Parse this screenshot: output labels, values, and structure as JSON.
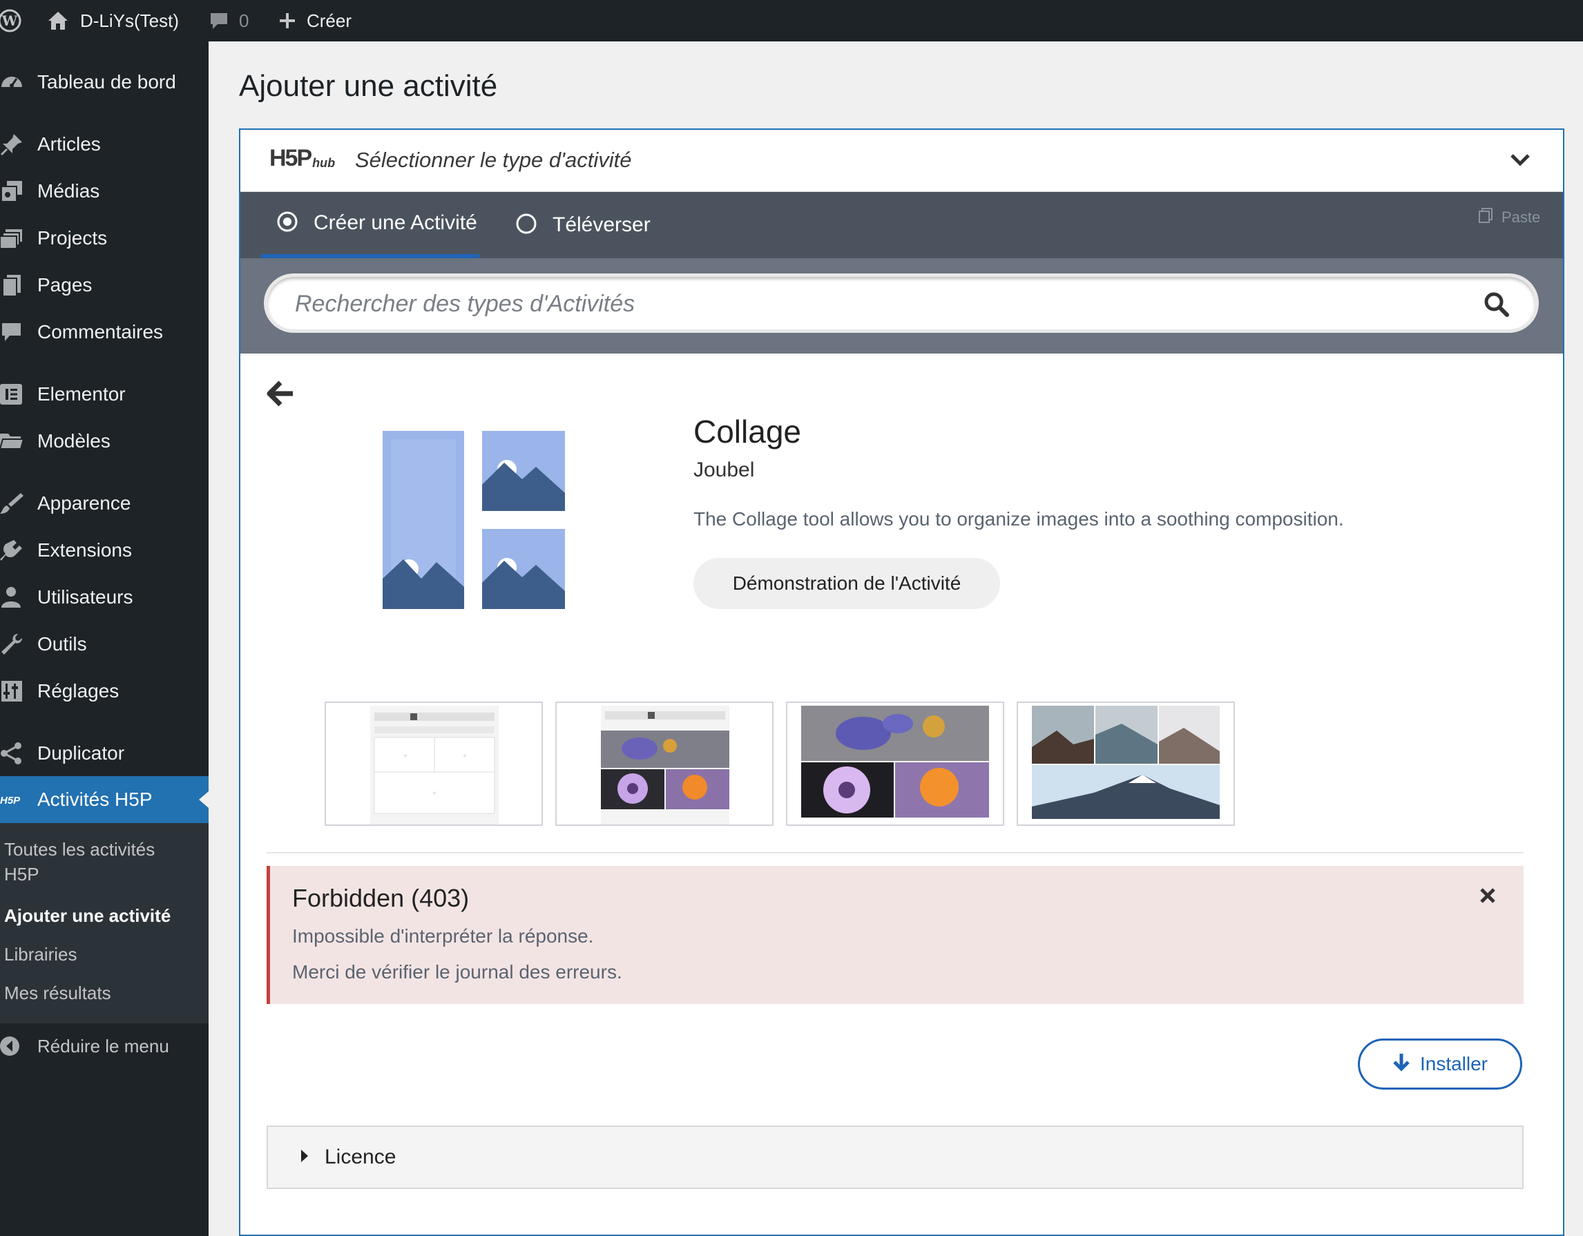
{
  "adminbar": {
    "site_name": "D-LiYs(Test)",
    "comments_count": "0",
    "new_label": "Créer"
  },
  "sidebar": {
    "items": [
      {
        "label": "Tableau de bord",
        "icon": "dashboard-icon"
      },
      {
        "label": "Articles",
        "icon": "pin-icon"
      },
      {
        "label": "Médias",
        "icon": "media-icon"
      },
      {
        "label": "Projects",
        "icon": "portfolio-icon"
      },
      {
        "label": "Pages",
        "icon": "pages-icon"
      },
      {
        "label": "Commentaires",
        "icon": "comments-icon"
      },
      {
        "label": "Elementor",
        "icon": "elementor-icon"
      },
      {
        "label": "Modèles",
        "icon": "folder-icon"
      },
      {
        "label": "Apparence",
        "icon": "brush-icon"
      },
      {
        "label": "Extensions",
        "icon": "plugin-icon"
      },
      {
        "label": "Utilisateurs",
        "icon": "users-icon"
      },
      {
        "label": "Outils",
        "icon": "wrench-icon"
      },
      {
        "label": "Réglages",
        "icon": "settings-icon"
      },
      {
        "label": "Duplicator",
        "icon": "share-icon"
      },
      {
        "label": "Activités H5P",
        "icon": "h5p-icon"
      }
    ],
    "submenu": [
      {
        "label": "Toutes les activités H5P"
      },
      {
        "label": "Ajouter une activité"
      },
      {
        "label": "Librairies"
      },
      {
        "label": "Mes résultats"
      }
    ],
    "collapse_label": "Réduire le menu"
  },
  "page": {
    "title": "Ajouter une activité"
  },
  "hub": {
    "logo_text": "H5P",
    "logo_sub": "hub",
    "select_label": "Sélectionner le type d'activité",
    "tabs": [
      {
        "label": "Créer une Activité",
        "selected": true
      },
      {
        "label": "Téléverser",
        "selected": false
      }
    ],
    "paste_label": "Paste",
    "search_placeholder": "Rechercher des types d'Activités"
  },
  "content_type": {
    "title": "Collage",
    "owner": "Joubel",
    "description": "The Collage tool allows you to organize images into a soothing composition.",
    "demo_label": "Démonstration de l'Activité",
    "screenshots_count": 4
  },
  "error": {
    "title": "Forbidden (403)",
    "line1": "Impossible d'interpréter la réponse.",
    "line2": "Merci de vérifier le journal des erreurs."
  },
  "install_label": "Installer",
  "licence_label": "Licence",
  "colors": {
    "wp_dark": "#1d2327",
    "wp_blue": "#2271b1",
    "hub_tabs": "#4b545e",
    "hub_search": "#6b7480",
    "h5p_blue": "#1e64b7",
    "error_bg": "#f3e4e4",
    "error_border": "#c4433d",
    "collage_light": "#9bb5ea",
    "collage_dark": "#3d5e8a"
  }
}
